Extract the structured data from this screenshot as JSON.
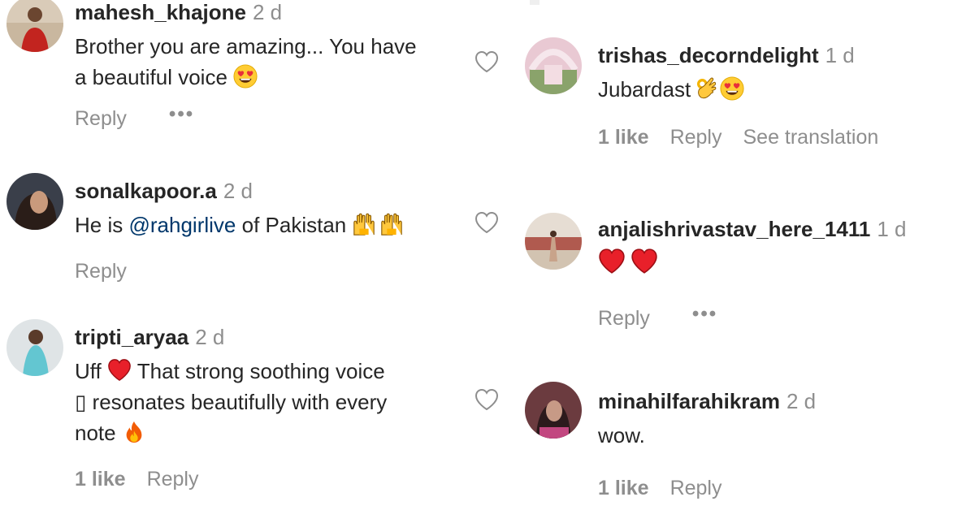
{
  "comments_left": [
    {
      "username": "mahesh_khajone",
      "time": "2 d",
      "text_line1": "Brother you are amazing... You have",
      "text_line2": "a beautiful voice",
      "reply": "Reply",
      "more": "•••"
    },
    {
      "username": "sonalkapoor.a",
      "time": "2 d",
      "text_before": "He is",
      "mention": "@rahgirlive",
      "text_after": "of Pakistan",
      "reply": "Reply"
    },
    {
      "username": "tripti_aryaa",
      "time": "2 d",
      "text_line1_a": "Uff",
      "text_line1_b": "That strong soothing voice",
      "text_line2": "▯ resonates beautifully with every",
      "text_line3": "note",
      "likes": "1 like",
      "reply": "Reply"
    }
  ],
  "comments_right": [
    {
      "username": "trishas_decorndelight",
      "time": "1 d",
      "text": "Jubardast",
      "likes": "1 like",
      "reply": "Reply",
      "translation": "See translation"
    },
    {
      "username": "anjalishrivastav_here_1411",
      "time": "1 d",
      "reply": "Reply",
      "more": "•••"
    },
    {
      "username": "minahilfarahikram",
      "time": "2 d",
      "text": "wow.",
      "likes": "1 like",
      "reply": "Reply"
    }
  ],
  "icons": {
    "like": "heart-outline-icon",
    "heart_eyes": "heart-eyes-emoji",
    "raised_hands": "raising-hands-emoji",
    "red_heart": "red-heart-emoji",
    "fire": "fire-emoji",
    "ok_hand": "ok-hand-emoji"
  },
  "colors": {
    "text": "#262626",
    "secondary": "#8e8e8e",
    "mention": "#00376b"
  }
}
